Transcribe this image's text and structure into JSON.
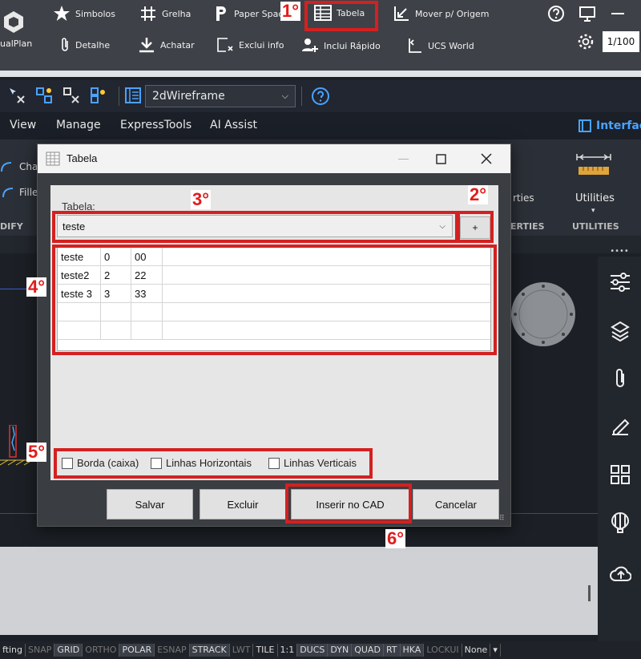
{
  "toolbar": {
    "row1": [
      "Simbolos",
      "Grelha",
      "Paper Spac",
      "Tabela",
      "Mover p/ Origem"
    ],
    "row2": [
      "Detalhe",
      "Achatar",
      "Exclui info",
      "Inclui Rápido",
      "UCS World"
    ],
    "app_label": "ualPlan",
    "scale": "1/100"
  },
  "annotations": [
    "1°",
    "2°",
    "3°",
    "4°",
    "5°",
    "6°"
  ],
  "qat": {
    "viewstyle": "2dWireframe"
  },
  "menu": {
    "items": [
      "View",
      "Manage",
      "ExpressTools",
      "AI Assist"
    ],
    "right": "Interfac"
  },
  "ribbon": {
    "cha": "Cha",
    "fille": "Fille",
    "rties": "rties",
    "utilities": "Utilities",
    "panel_labels": [
      "DIFY",
      "ERTIES",
      "UTILITIES"
    ]
  },
  "dialog": {
    "title": "Tabela",
    "label": "Tabela:",
    "selected_table": "teste",
    "add_button": "+",
    "rows": [
      [
        "teste",
        "0",
        "00"
      ],
      [
        "teste2",
        "2",
        "22"
      ],
      [
        "teste 3",
        "3",
        "33"
      ],
      [
        "",
        "",
        ""
      ],
      [
        "",
        "",
        ""
      ]
    ],
    "checkboxes": [
      "Borda (caixa)",
      "Linhas Horizontais",
      "Linhas Verticais"
    ],
    "buttons": {
      "save": "Salvar",
      "delete": "Excluir",
      "insert": "Inserir no CAD",
      "cancel": "Cancelar"
    }
  },
  "statusbar": [
    {
      "t": "fting",
      "s": "n"
    },
    {
      "t": "SNAP",
      "s": "off"
    },
    {
      "t": "GRID",
      "s": "on"
    },
    {
      "t": "ORTHO",
      "s": "off"
    },
    {
      "t": "POLAR",
      "s": "on"
    },
    {
      "t": "ESNAP",
      "s": "off"
    },
    {
      "t": "STRACK",
      "s": "on"
    },
    {
      "t": "LWT",
      "s": "off"
    },
    {
      "t": "TILE",
      "s": "n"
    },
    {
      "t": "1:1",
      "s": "n"
    },
    {
      "t": "DUCS",
      "s": "on"
    },
    {
      "t": "DYN",
      "s": "on"
    },
    {
      "t": "QUAD",
      "s": "on"
    },
    {
      "t": "RT",
      "s": "on"
    },
    {
      "t": "HKA",
      "s": "on"
    },
    {
      "t": "LOCKUI",
      "s": "off"
    },
    {
      "t": "None",
      "s": "n"
    }
  ]
}
